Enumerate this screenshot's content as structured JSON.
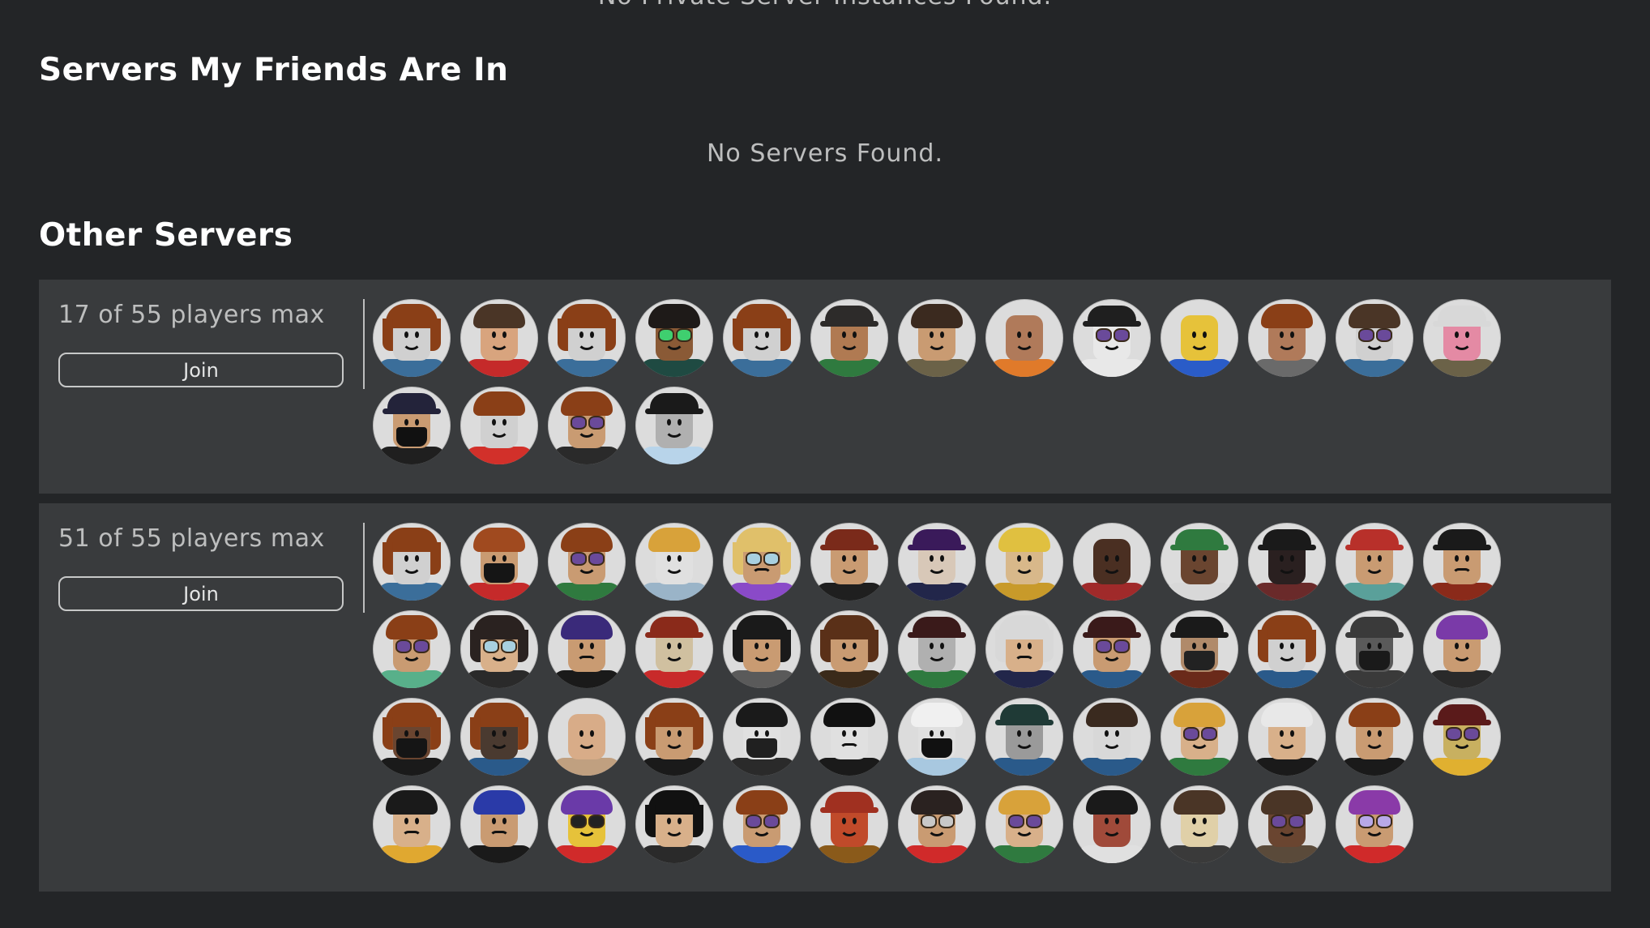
{
  "private_servers": {
    "empty_message": "No Private Server Instances Found."
  },
  "friends_section": {
    "title": "Servers My Friends Are In",
    "empty_message": "No Servers Found."
  },
  "other_section": {
    "title": "Other Servers",
    "servers": [
      {
        "player_count_label": "17 of 55 players max",
        "players_current": 17,
        "players_max": 55,
        "join_label": "Join",
        "players": [
          {
            "skin": "#d0d0d0",
            "hair": "#8a3f17",
            "hair_style": "long",
            "torso": "#3b6e9a"
          },
          {
            "skin": "#d8a47e",
            "hair": "#4a3526",
            "hair_style": "short",
            "torso": "#c52a2a"
          },
          {
            "skin": "#d0d0d0",
            "hair": "#8a3f17",
            "hair_style": "long",
            "torso": "#3b6e9a"
          },
          {
            "skin": "#8a5a36",
            "hair": "#1e1a18",
            "hair_style": "short",
            "glasses": "#3fcf6f",
            "torso": "#1f4a42"
          },
          {
            "skin": "#d0d0d0",
            "hair": "#8a3f17",
            "hair_style": "long",
            "torso": "#3b6e9a"
          },
          {
            "skin": "#b07a52",
            "hat": "#2d2b2a",
            "torso": "#2f7a3f"
          },
          {
            "skin": "#c99b72",
            "hair": "#3b2a1f",
            "hair_style": "short",
            "torso": "#6b6248"
          },
          {
            "skin": "#b07a5a",
            "torso": "#e07a2a"
          },
          {
            "skin": "#e8e8e8",
            "hat": "#1f1f1f",
            "glasses": "#6a4a9a",
            "torso": "#e8e8e8"
          },
          {
            "skin": "#e6c23a",
            "torso": "#2a5cc8"
          },
          {
            "skin": "#b07a5a",
            "hair": "#8a3f17",
            "hair_style": "short",
            "torso": "#6a6a6a"
          },
          {
            "skin": "#d0d0d0",
            "hair": "#4a3526",
            "hair_style": "short",
            "glasses": "#6a4a9a",
            "torso": "#3b6e9a"
          },
          {
            "skin": "#e48aa4",
            "hat": "#d8d8d8",
            "torso": "#6b6248"
          },
          {
            "skin": "#c99b72",
            "hat": "#23233a",
            "mask": "#111111",
            "torso": "#1f1f1f"
          },
          {
            "skin": "#d0d0d0",
            "hair": "#8a3f17",
            "hair_style": "short",
            "torso": "#d2302a"
          },
          {
            "skin": "#c99b72",
            "hair": "#8a3f17",
            "hair_style": "short",
            "glasses": "#6a4a9a",
            "torso": "#2a2a2a"
          },
          {
            "skin": "#b0b0b0",
            "hat": "#1a1a1a",
            "torso": "#b8d4ea"
          }
        ]
      },
      {
        "player_count_label": "51 of 55 players max",
        "players_current": 51,
        "players_max": 55,
        "join_label": "Join",
        "players": [
          {
            "skin": "#d0d0d0",
            "hair": "#8a3f17",
            "hair_style": "long",
            "torso": "#3b6e9a"
          },
          {
            "skin": "#c99b72",
            "hair": "#a04a1f",
            "hair_style": "short",
            "mask": "#151515",
            "torso": "#c52a2a"
          },
          {
            "skin": "#c99b72",
            "hair": "#8a3f17",
            "hair_style": "short",
            "glasses": "#6a4a9a",
            "torso": "#2f7a3f"
          },
          {
            "skin": "#e0e0e0",
            "hair": "#d8a23a",
            "hair_style": "short",
            "torso": "#9ab4c8"
          },
          {
            "skin": "#c99b72",
            "hair": "#e0c06a",
            "hair_style": "long",
            "glasses": "#a8d0e0",
            "mouth": "frown",
            "torso": "#8a4ac8"
          },
          {
            "skin": "#c99b72",
            "hat": "#7a2a1a",
            "torso": "#1f1f1f"
          },
          {
            "skin": "#d8c8b8",
            "hat": "#3a1a5a",
            "torso": "#22264a"
          },
          {
            "skin": "#d8b88a",
            "hair": "#e0c040",
            "hair_style": "short",
            "torso": "#c89a2a"
          },
          {
            "skin": "#4a2f22",
            "torso": "#a02a2a"
          },
          {
            "skin": "#6a4530",
            "hat": "#2f7a3f",
            "torso": "#d8d8d8"
          },
          {
            "skin": "#2a2020",
            "hat": "#1a1a1a",
            "torso": "#6a2a2a"
          },
          {
            "skin": "#c99b72",
            "hat": "#b8302a",
            "torso": "#5aa09a"
          },
          {
            "skin": "#c99b72",
            "hat": "#1a1a1a",
            "mouth": "frown",
            "torso": "#8a2a1a"
          },
          {
            "skin": "#c99b72",
            "hair": "#8a3f17",
            "hair_style": "short",
            "glasses": "#6a4a9a",
            "torso": "#58b08a"
          },
          {
            "skin": "#d8b08a",
            "hair": "#2a2220",
            "hair_style": "long",
            "glasses": "#a8d0e0",
            "torso": "#2a2a2a"
          },
          {
            "skin": "#c99b72",
            "hair": "#3a2a7a",
            "hair_style": "short",
            "mouth": "frown",
            "torso": "#1a1a1a"
          },
          {
            "skin": "#d0c0a0",
            "hat": "#8a2a1a",
            "torso": "#c82a2a"
          },
          {
            "skin": "#c99b72",
            "hair": "#1a1a1a",
            "hair_style": "long",
            "torso": "#5a5a5a"
          },
          {
            "skin": "#c99b72",
            "hair": "#5a3018",
            "hair_style": "long",
            "torso": "#3a2a1a"
          },
          {
            "skin": "#b0b0b0",
            "hat": "#3a1a1a",
            "torso": "#2f7a3f"
          },
          {
            "skin": "#d8b08a",
            "hair": "#d8d8d8",
            "hair_style": "long",
            "mouth": "frown",
            "torso": "#22264a"
          },
          {
            "skin": "#c99b72",
            "hat": "#3a1a1a",
            "glasses": "#6a4a9a",
            "torso": "#2a5a8a"
          },
          {
            "skin": "#b08a6a",
            "hat": "#1a1a1a",
            "mask": "#222222",
            "torso": "#6a2a1a"
          },
          {
            "skin": "#d0d0d0",
            "hair": "#8a3f17",
            "hair_style": "long",
            "torso": "#2a5a8a"
          },
          {
            "skin": "#5a5a5a",
            "hat": "#3a3a3a",
            "mask": "#1a1a1a",
            "torso": "#3a3a3a"
          },
          {
            "skin": "#c99b72",
            "hair": "#7a3aa8",
            "hair_style": "short",
            "torso": "#2a2a2a"
          },
          {
            "skin": "#6a4530",
            "hair": "#8a3f17",
            "hair_style": "long",
            "mask": "#151515",
            "torso": "#1a1a1a"
          },
          {
            "skin": "#4a3a30",
            "hair": "#8a3f17",
            "hair_style": "long",
            "torso": "#2a5a8a"
          },
          {
            "skin": "#d8ac88",
            "torso": "#c0a080"
          },
          {
            "skin": "#c99b72",
            "hair": "#8a3f17",
            "hair_style": "long",
            "torso": "#1a1a1a"
          },
          {
            "skin": "#e0e0e0",
            "hair": "#1a1a1a",
            "hair_style": "short",
            "mask": "#202020",
            "torso": "#2a2a2a"
          },
          {
            "skin": "#e0e0e0",
            "hair": "#111111",
            "hair_style": "short",
            "mouth": "frown",
            "torso": "#1a1a1a"
          },
          {
            "skin": "#e0e0e0",
            "hair": "#f0f0f0",
            "hair_style": "short",
            "mask": "#111111",
            "torso": "#a8c8e0"
          },
          {
            "skin": "#9a9a9a",
            "hat": "#1f3a36",
            "torso": "#2a5a8a"
          },
          {
            "skin": "#d8d8d8",
            "hair": "#3a2a1f",
            "hair_style": "short",
            "torso": "#2a5a8a"
          },
          {
            "skin": "#d8b08a",
            "hair": "#d8a23a",
            "hair_style": "short",
            "glasses": "#6a4a9a",
            "torso": "#2f7a3f"
          },
          {
            "skin": "#d8b08a",
            "hair": "#e8e8e8",
            "hair_style": "short",
            "torso": "#1a1a1a"
          },
          {
            "skin": "#c99b72",
            "hair": "#8a3f17",
            "hair_style": "short",
            "torso": "#1a1a1a"
          },
          {
            "skin": "#c8b060",
            "hat": "#5a1a1a",
            "glasses": "#6a4a9a",
            "torso": "#e0b030"
          },
          {
            "skin": "#d8b08a",
            "hair": "#1a1a1a",
            "hair_style": "short",
            "mouth": "frown",
            "torso": "#e0a830"
          },
          {
            "skin": "#c99b72",
            "hair": "#2a3aa8",
            "hair_style": "short",
            "mouth": "frown",
            "torso": "#1a1a1a"
          },
          {
            "skin": "#e6c23a",
            "hair": "#6a3aa8",
            "hair_style": "short",
            "glasses": "#222222",
            "torso": "#d02a2a"
          },
          {
            "skin": "#d8b08a",
            "hair": "#111111",
            "hair_style": "long",
            "torso": "#2a2a2a"
          },
          {
            "skin": "#c99b72",
            "hair": "#8a3f17",
            "hair_style": "short",
            "glasses": "#6a4a9a",
            "torso": "#2a5ac8"
          },
          {
            "skin": "#c04a2a",
            "hat": "#a03020",
            "torso": "#8a5a1a"
          },
          {
            "skin": "#c99b72",
            "hair": "#2a2220",
            "hair_style": "short",
            "glasses": "#c8c8c8",
            "torso": "#d02a2a"
          },
          {
            "skin": "#d8b08a",
            "hair": "#d8a23a",
            "hair_style": "short",
            "glasses": "#6a4a9a",
            "torso": "#2f7a3f"
          },
          {
            "skin": "#a04a3a",
            "hair": "#1a1a1a",
            "hair_style": "short",
            "torso": "#e0e0e0"
          },
          {
            "skin": "#e0d0a8",
            "hair": "#4a3526",
            "hair_style": "short",
            "torso": "#3a3a3a"
          },
          {
            "skin": "#6a4530",
            "hair": "#4a3526",
            "hair_style": "short",
            "glasses": "#6a4a9a",
            "torso": "#5a4a3a"
          },
          {
            "skin": "#c99b72",
            "hair": "#8a3aa8",
            "hair_style": "short",
            "glasses": "#b8a8e8",
            "torso": "#d02a2a"
          }
        ]
      }
    ]
  },
  "colors": {
    "page_background": "#232527",
    "card_background": "#393b3d",
    "heading_text": "#ffffff",
    "secondary_text": "#bdbebe",
    "button_border": "#c7c8c8"
  }
}
